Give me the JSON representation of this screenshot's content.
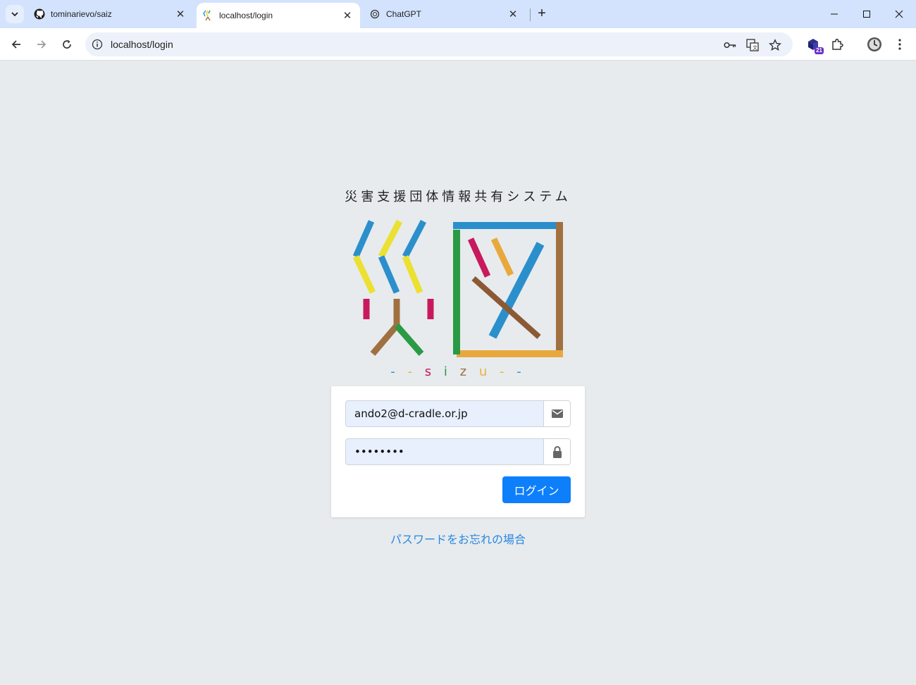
{
  "browser": {
    "tabs": [
      {
        "title": "tominarievo/saiz",
        "icon": "github-icon"
      },
      {
        "title": "localhost/login",
        "icon": "sai-favicon",
        "active": true
      },
      {
        "title": "ChatGPT",
        "icon": "chatgpt-icon"
      }
    ],
    "url": "localhost/login",
    "extension_badge": "21"
  },
  "page": {
    "app_title": "災害支援団体情報共有システム",
    "sizu": [
      "-",
      "-",
      "s",
      "i",
      "z",
      "u",
      "-",
      "-"
    ],
    "sizu_colors": [
      "#2b8fcc",
      "#e8b43c",
      "#c8195f",
      "#2a9a44",
      "#a07040",
      "#e8b43c",
      "#e8b43c",
      "#2b8fcc"
    ],
    "email": {
      "value": "ando2@d-cradle.or.jp"
    },
    "password": {
      "value": "••••••••"
    },
    "login_button": "ログイン",
    "forgot_link": "パスワードをお忘れの場合"
  },
  "colors": {
    "blue": "#2b8fcc",
    "yellow": "#ece030",
    "magenta": "#c8195f",
    "brown": "#a07040",
    "green": "#2a9a44",
    "orange": "#e8a93c",
    "button": "#0d7ffb"
  }
}
